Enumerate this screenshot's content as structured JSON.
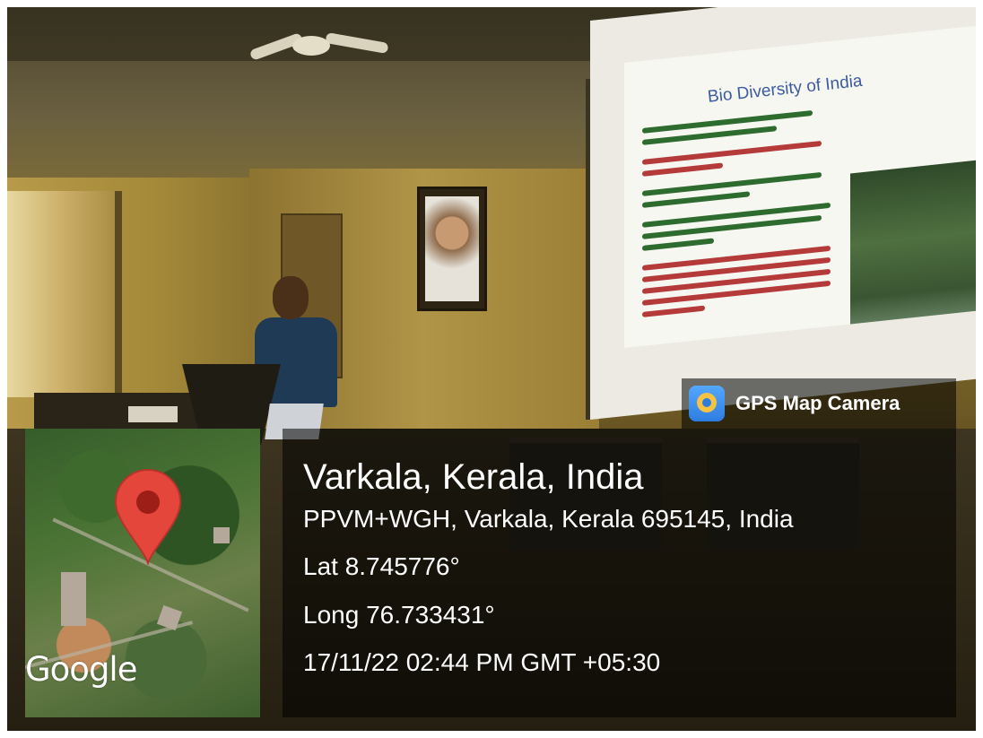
{
  "badge": {
    "label": "GPS Map Camera",
    "icon": "gps-map-camera-icon",
    "icon_color": "#2d7de0"
  },
  "map": {
    "logo_text": "Google",
    "pin_color": "#e5463b",
    "pin_icon": "map-pin-icon"
  },
  "location": {
    "place": "Varkala, Kerala, India",
    "address": "PPVM+WGH, Varkala, Kerala 695145, India",
    "lat": "Lat 8.745776°",
    "long": "Long 76.733431°",
    "datetime": "17/11/22 02:44 PM GMT +05:30"
  },
  "slide": {
    "title": "Bio Diversity of India",
    "title_color": "#3b5aa0"
  }
}
